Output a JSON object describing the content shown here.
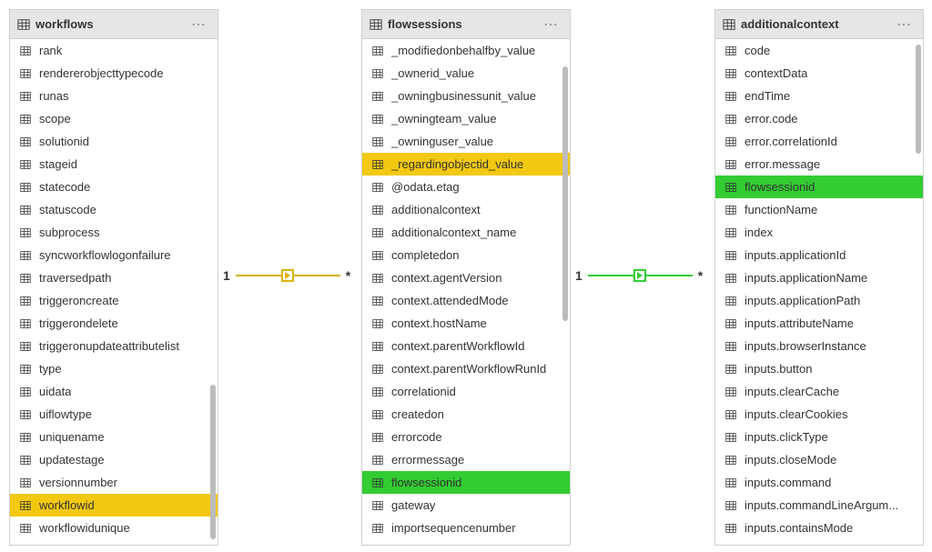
{
  "tables": {
    "workflows": {
      "title": "workflows",
      "fields": [
        "rank",
        "rendererobjecttypecode",
        "runas",
        "scope",
        "solutionid",
        "stageid",
        "statecode",
        "statuscode",
        "subprocess",
        "syncworkflowlogonfailure",
        "traversedpath",
        "triggeroncreate",
        "triggerondelete",
        "triggeronupdateattributelist",
        "type",
        "uidata",
        "uiflowtype",
        "uniquename",
        "updatestage",
        "versionnumber",
        "workflowid",
        "workflowidunique"
      ],
      "highlight": {
        "workflowid": "yellow"
      }
    },
    "flowsessions": {
      "title": "flowsessions",
      "fields": [
        "_modifiedonbehalfby_value",
        "_ownerid_value",
        "_owningbusinessunit_value",
        "_owningteam_value",
        "_owninguser_value",
        "_regardingobjectid_value",
        "@odata.etag",
        "additionalcontext",
        "additionalcontext_name",
        "completedon",
        "context.agentVersion",
        "context.attendedMode",
        "context.hostName",
        "context.parentWorkflowId",
        "context.parentWorkflowRunId",
        "correlationid",
        "createdon",
        "errorcode",
        "errormessage",
        "flowsessionid",
        "gateway",
        "importsequencenumber"
      ],
      "highlight": {
        "_regardingobjectid_value": "yellow",
        "flowsessionid": "green"
      }
    },
    "additionalcontext": {
      "title": "additionalcontext",
      "fields": [
        "code",
        "contextData",
        "endTime",
        "error.code",
        "error.correlationId",
        "error.message",
        "flowsessionid",
        "functionName",
        "index",
        "inputs.applicationId",
        "inputs.applicationName",
        "inputs.applicationPath",
        "inputs.attributeName",
        "inputs.browserInstance",
        "inputs.button",
        "inputs.clearCache",
        "inputs.clearCookies",
        "inputs.clickType",
        "inputs.closeMode",
        "inputs.command",
        "inputs.commandLineArgum...",
        "inputs.containsMode"
      ],
      "highlight": {
        "flowsessionid": "green"
      }
    }
  },
  "relationships": [
    {
      "from": "workflows",
      "to": "flowsessions",
      "fromCard": "1",
      "toCard": "*",
      "color": "yellow"
    },
    {
      "from": "flowsessions",
      "to": "additionalcontext",
      "fromCard": "1",
      "toCard": "*",
      "color": "green"
    }
  ]
}
